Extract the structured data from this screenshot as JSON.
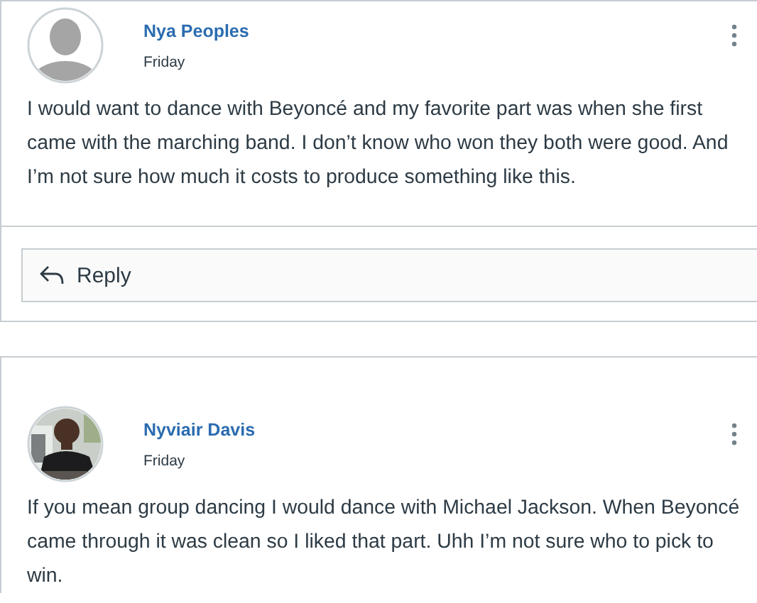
{
  "posts": [
    {
      "author": "Nya Peoples",
      "date": "Friday",
      "avatar": {
        "kind": "placeholder"
      },
      "body": "I would want to dance with Beyoncé and my favorite part was when she first came with the marching band. I don’t know who won they both were good. And I’m not sure how much it costs to produce something like this.",
      "reply_button": "Reply"
    },
    {
      "author": "Nyviair Davis",
      "date": "Friday",
      "body": "If you mean group dancing I would dance with Michael Jackson. When Beyoncé came through it was clean so I liked that part. Uhh I’m not sure who to pick to win."
    }
  ]
}
